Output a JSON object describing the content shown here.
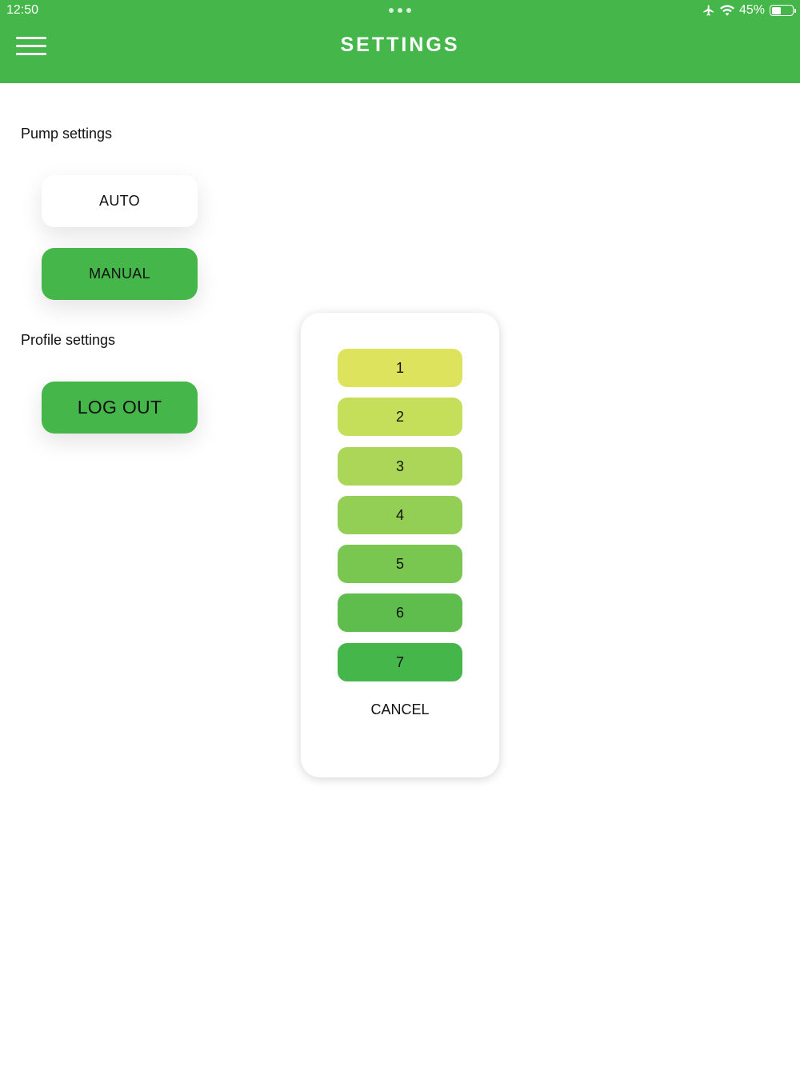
{
  "status_bar": {
    "time": "12:50",
    "battery_percent_label": "45%",
    "battery_level": 0.45,
    "icons": [
      "airplane-icon",
      "wifi-icon",
      "battery-icon"
    ]
  },
  "header": {
    "title": "SETTINGS",
    "menu_icon": "hamburger-menu-icon",
    "color": "#45b649"
  },
  "pump": {
    "label": "Pump settings",
    "auto_label": "AUTO",
    "manual_label": "MANUAL"
  },
  "profile": {
    "label": "Profile settings",
    "logout_label": "LOG OUT"
  },
  "picker": {
    "options": [
      {
        "label": "1",
        "color": "#dde35c"
      },
      {
        "label": "2",
        "color": "#c5df5a"
      },
      {
        "label": "3",
        "color": "#acd657"
      },
      {
        "label": "4",
        "color": "#92cf54"
      },
      {
        "label": "5",
        "color": "#79c651"
      },
      {
        "label": "6",
        "color": "#5ebd4d"
      },
      {
        "label": "7",
        "color": "#45b649"
      }
    ],
    "cancel_label": "CANCEL"
  }
}
